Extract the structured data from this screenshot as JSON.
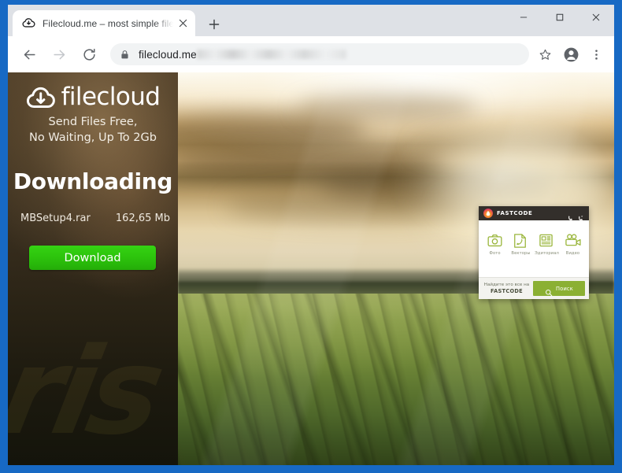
{
  "window": {
    "controls": [
      {
        "name": "minimize",
        "glyph": "–"
      },
      {
        "name": "maximize",
        "glyph": "□"
      },
      {
        "name": "close",
        "glyph": "✕"
      }
    ]
  },
  "tabstrip": {
    "tabs": [
      {
        "favicon": "filecloud-cloud-icon",
        "title": "Filecloud.me – most simple file sh",
        "close_glyph": "✕"
      }
    ],
    "new_tab_glyph": "+",
    "new_tab_label": "New Tab"
  },
  "toolbar": {
    "back_label": "Back",
    "forward_label": "Forward",
    "reload_label": "Reload",
    "lock_label": "View site information",
    "url_visible": "filecloud.me",
    "url_redacted": true,
    "bookmark_label": "Bookmark this tab",
    "profile_label": "Profile",
    "menu_label": "Customize and control Google Chrome"
  },
  "page": {
    "sidebar": {
      "logo_text": "filecloud",
      "tagline_line1": "Send Files Free,",
      "tagline_line2": "No Waiting, Up To 2Gb",
      "heading": "Downloading",
      "file_name": "MBSetup4.rar",
      "file_size": "162,65 Mb",
      "download_button": "Download",
      "watermark_text": "ris",
      "accent_green": "#2cc20c",
      "background_dark": "#2b2416"
    },
    "hero_image": {
      "description": "Golden sunset over a misty green farm field",
      "sky_color": "#d8b77e",
      "field_color": "#6d8537"
    },
    "fastcode_widget": {
      "brand": "FASTCODE",
      "header_color": "#332f2b",
      "accent_green": "#8bb033",
      "header_icons": [
        "phone-icon",
        "phone-forward-icon"
      ],
      "items": [
        {
          "icon": "camera-icon",
          "label": "Фото"
        },
        {
          "icon": "vector-pen-icon",
          "label": "Векторы"
        },
        {
          "icon": "newspaper-icon",
          "label": "Эдиториал"
        },
        {
          "icon": "video-camera-icon",
          "label": "Видео"
        }
      ],
      "footer_text": "Найдите это все на",
      "footer_brand": "FASTCODE",
      "search_button": "Поиск"
    }
  },
  "chrome_colors": {
    "frame_blue": "#1769c4",
    "tabstrip_grey": "#dee1e6",
    "omnibox_grey": "#f1f3f4"
  }
}
